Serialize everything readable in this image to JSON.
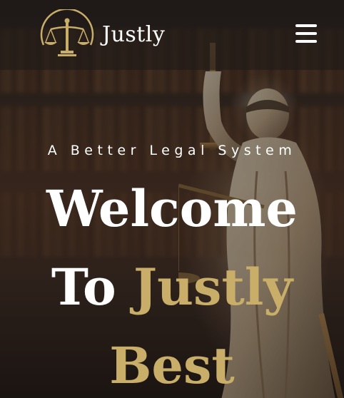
{
  "brand": {
    "name": "Justly"
  },
  "hero": {
    "tagline": "A Better Legal System",
    "line1": "Welcome",
    "line2_white": "To",
    "line2_gold": "Justly",
    "line3": "Best"
  },
  "colors": {
    "accent_gold": "#c9ae6a",
    "text_white": "#ffffff"
  },
  "icons": {
    "logo": "scales-of-justice-icon",
    "menu": "hamburger-menu-icon"
  }
}
